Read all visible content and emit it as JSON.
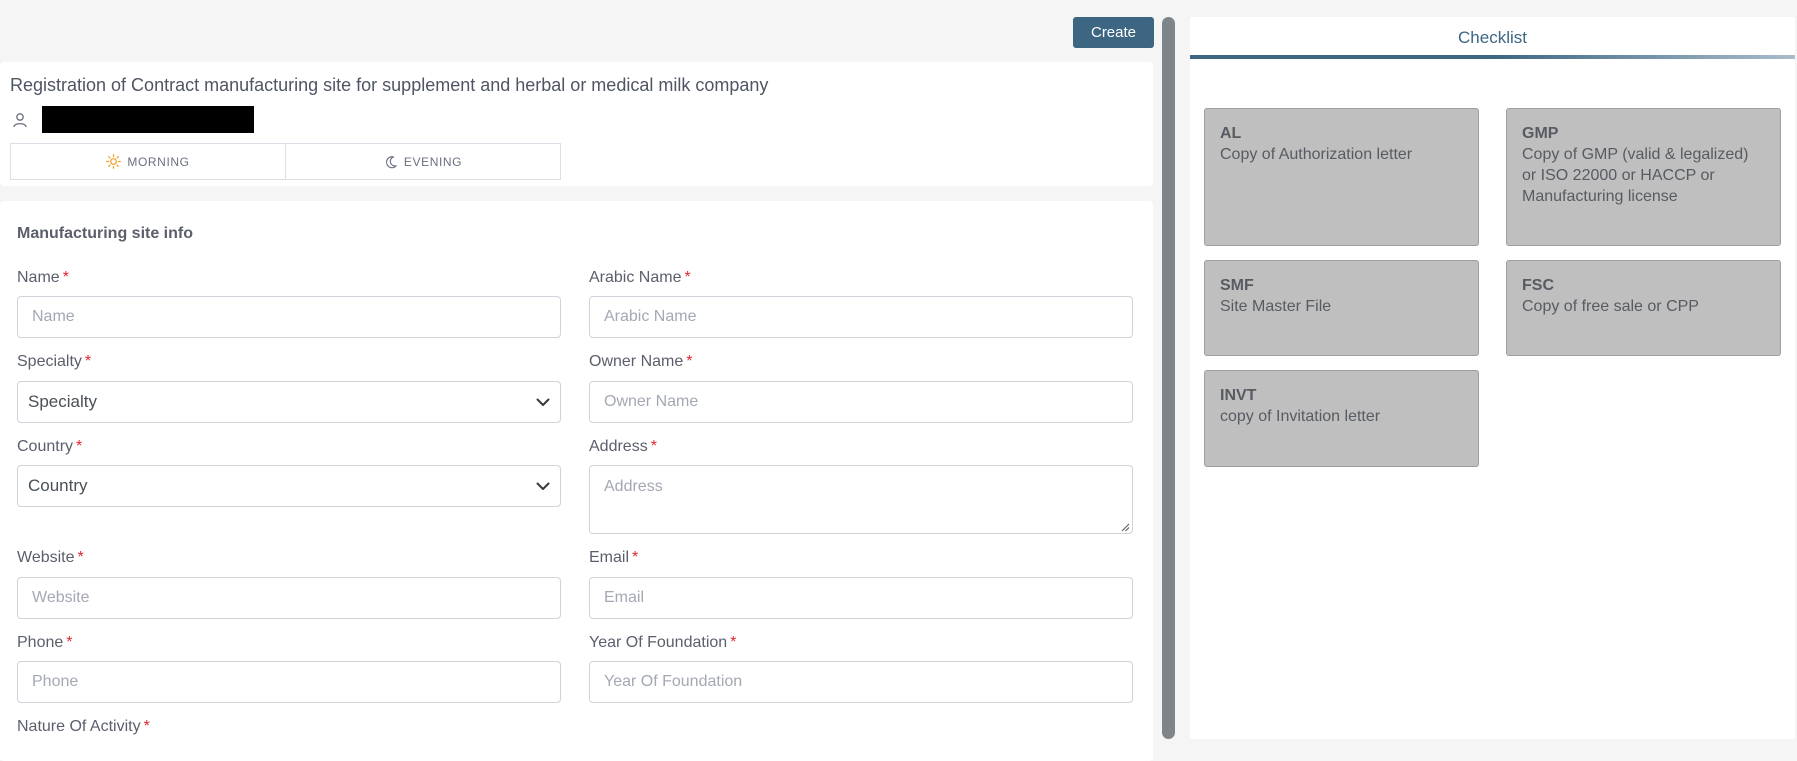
{
  "toolbar": {
    "create_label": "Create"
  },
  "header": {
    "title": "Registration of Contract manufacturing site for supplement and herbal or medical milk company",
    "shifts": [
      {
        "label": "MORNING",
        "icon": "sun-icon"
      },
      {
        "label": "EVENING",
        "icon": "moon-icon"
      }
    ]
  },
  "form": {
    "section_title": "Manufacturing site info",
    "required_mark": "*",
    "name": {
      "label": "Name",
      "placeholder": "Name"
    },
    "arabic_name": {
      "label": "Arabic Name",
      "placeholder": "Arabic Name"
    },
    "specialty": {
      "label": "Specialty",
      "value": "Specialty"
    },
    "owner_name": {
      "label": "Owner Name",
      "placeholder": "Owner Name"
    },
    "country": {
      "label": "Country",
      "value": "Country"
    },
    "address": {
      "label": "Address",
      "placeholder": "Address"
    },
    "website": {
      "label": "Website",
      "placeholder": "Website"
    },
    "email": {
      "label": "Email",
      "placeholder": "Email"
    },
    "phone": {
      "label": "Phone",
      "placeholder": "Phone"
    },
    "year_of_foundation": {
      "label": "Year Of Foundation",
      "placeholder": "Year Of Foundation"
    },
    "nature_of_activity": {
      "label": "Nature Of Activity"
    }
  },
  "checklist": {
    "tab_label": "Checklist",
    "items": [
      {
        "code": "AL",
        "description": "Copy of Authorization letter"
      },
      {
        "code": "GMP",
        "description": "Copy of GMP (valid & legalized) or ISO 22000 or HACCP or Manufacturing license"
      },
      {
        "code": "SMF",
        "description": "Site Master File"
      },
      {
        "code": "FSC",
        "description": "Copy of free sale or CPP"
      },
      {
        "code": "INVT",
        "description": "copy of Invitation letter"
      }
    ]
  },
  "colors": {
    "accent": "#3d6683",
    "required": "#e3262f",
    "checklist_card": "#bfbfbf",
    "shift_sun": "#f0a020"
  }
}
